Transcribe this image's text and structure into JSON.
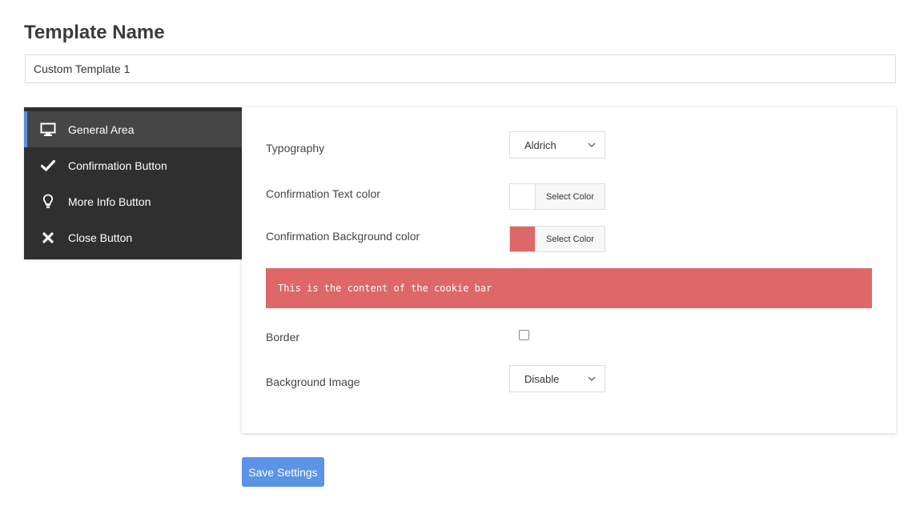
{
  "header": {
    "title": "Template Name"
  },
  "template_name": {
    "value": "Custom Template 1"
  },
  "sidebar": {
    "items": [
      {
        "label": "General Area",
        "icon": "monitor-icon",
        "active": true
      },
      {
        "label": "Confirmation Button",
        "icon": "checkmark-icon",
        "active": false
      },
      {
        "label": "More Info Button",
        "icon": "lightbulb-icon",
        "active": false
      },
      {
        "label": "Close Button",
        "icon": "close-icon",
        "active": false
      }
    ]
  },
  "panel": {
    "typography": {
      "label": "Typography",
      "value": "Aldrich"
    },
    "text_color": {
      "label": "Confirmation Text color",
      "button": "Select Color",
      "color": "#ffffff"
    },
    "bg_color": {
      "label": "Confirmation Background color",
      "button": "Select Color",
      "color": "#de6767"
    },
    "preview": {
      "text": "This is the content of the cookie bar",
      "background": "#de6767",
      "text_color": "#ffffff"
    },
    "border": {
      "label": "Border",
      "checked": false
    },
    "bg_image": {
      "label": "Background Image",
      "value": "Disable"
    }
  },
  "actions": {
    "save_label": "Save Settings",
    "save_color": "#5b93e6"
  }
}
